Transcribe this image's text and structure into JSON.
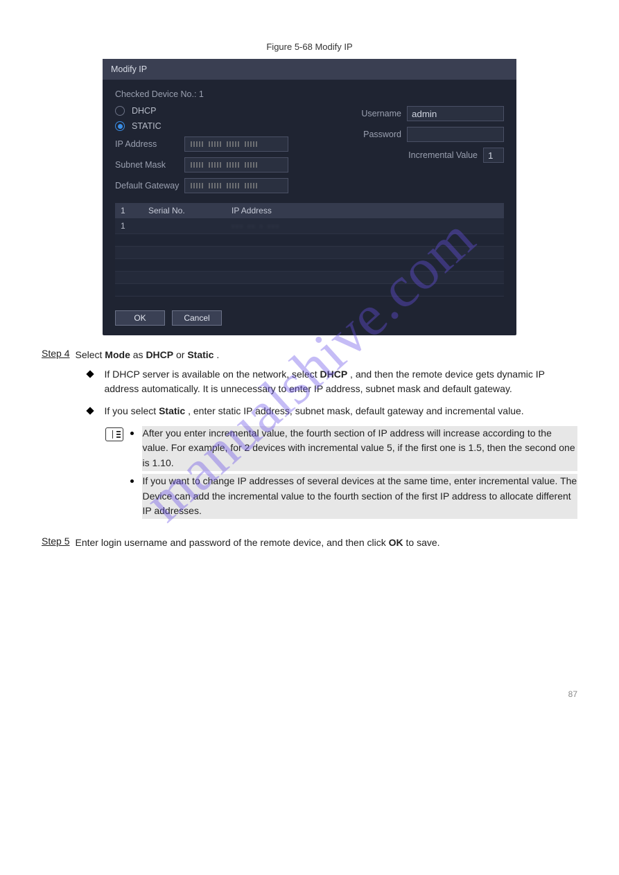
{
  "figure_label": "Figure 5-68 Modify IP",
  "dialog": {
    "title": "Modify IP",
    "checked_label": "Checked Device No.: 1",
    "radio_dhcp": "DHCP",
    "radio_static": "STATIC",
    "username_label": "Username",
    "username_value": "admin",
    "password_label": "Password",
    "password_value": "",
    "ip_label": "IP Address",
    "subnet_label": "Subnet Mask",
    "gateway_label": "Default Gateway",
    "incremental_label": "Incremental Value",
    "incremental_value": "1",
    "table": {
      "col1": "1",
      "col2": "Serial No.",
      "col3": "IP Address",
      "row1_no": "1",
      "row1_serial": "",
      "row1_ip_blur": "··· ·· · ···"
    },
    "ok": "OK",
    "cancel": "Cancel"
  },
  "step4": {
    "label": "Step 4",
    "text_a": "Select ",
    "mode": "Mode",
    "text_b": " as ",
    "dhcp": "DHCP",
    "or": " or ",
    "static": "Static",
    "dot": "."
  },
  "bullet_dhcp": {
    "a": "If DHCP server is available on the network, select ",
    "dhcp": "DHCP",
    "b": ", and then the remote device gets dynamic IP address automatically. It is unnecessary to enter IP address, subnet mask and default gateway."
  },
  "bullet_static": {
    "a": "If you select ",
    "static": "Static",
    "b": ", enter static IP address, subnet mask, default gateway and incremental value."
  },
  "notes": {
    "n1": "After you enter incremental value, the fourth section of IP address will increase according to the value. For example, for 2 devices with incremental value 5, if the first one is 1.5, then the second one is 1.10.",
    "n2": "If you want to change IP addresses of several devices at the same time, enter incremental value. The Device can add the incremental value to the fourth section of the first IP address to allocate different IP addresses."
  },
  "step5": {
    "label": "Step 5",
    "a": "Enter login username and password of the remote device, and then click ",
    "ok": "OK",
    "b": " to save."
  },
  "page_number": "87",
  "watermark": "manualshive.com"
}
